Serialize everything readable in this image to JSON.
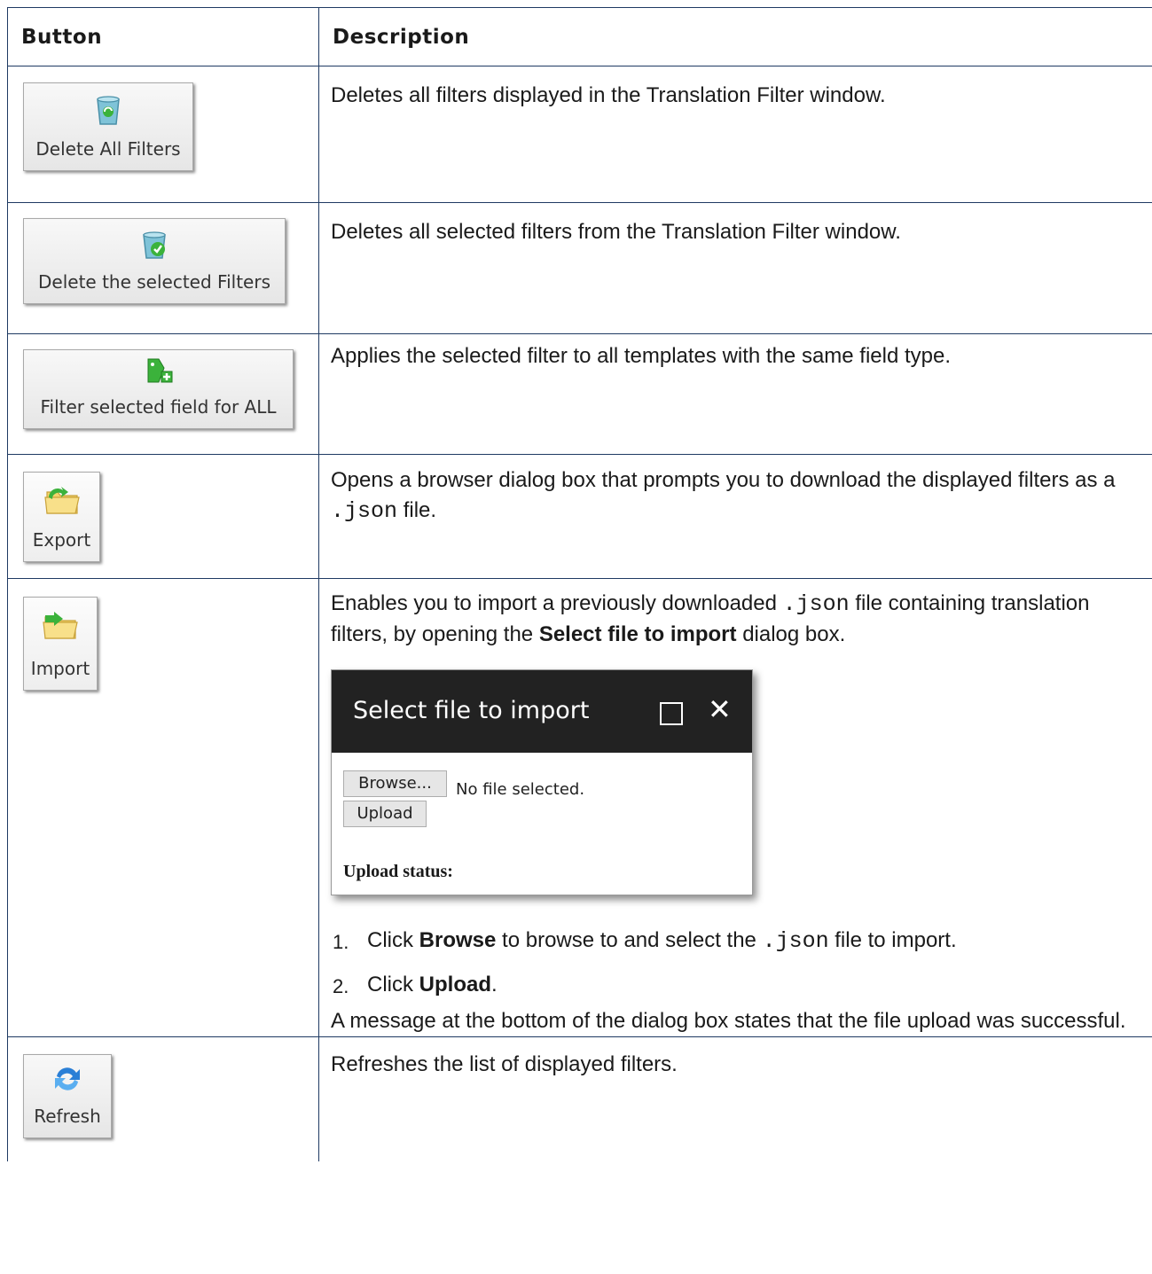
{
  "table": {
    "headers": {
      "button": "Button",
      "description": "Description"
    },
    "rows": [
      {
        "button_label": "Delete All Filters",
        "icon": "recycle-bin-icon",
        "description": "Deletes all filters displayed in the Translation Filter window."
      },
      {
        "button_label": "Delete the selected Filters",
        "icon": "recycle-bin-check-icon",
        "description": "Deletes all selected filters from the Translation Filter window."
      },
      {
        "button_label": "Filter selected field for ALL",
        "icon": "green-tag-add-icon",
        "description": "Applies the selected filter to all templates with the same field type."
      },
      {
        "button_label": "Export",
        "icon": "folder-export-icon",
        "description_pre": "Opens a browser dialog box that prompts you to download the displayed filters as a",
        "description_code": ".json",
        "description_post": "file."
      },
      {
        "button_label": "Import",
        "icon": "folder-import-icon",
        "description_pre": "Enables you to import a previously downloaded",
        "description_code": ".json",
        "description_mid": "file containing translation filters, by opening the",
        "description_bold": "Select file to import",
        "description_post": "dialog box.",
        "dialog": {
          "title": "Select file to import",
          "browse_label": "Browse...",
          "no_file_text": "No file selected.",
          "upload_label": "Upload",
          "status_label": "Upload status:"
        },
        "steps": [
          {
            "num": "1.",
            "pre": "Click",
            "bold": "Browse",
            "post": "to browse to and select the",
            "code": ".json",
            "post2": "file to import."
          },
          {
            "num": "2.",
            "pre": "Click",
            "bold": "Upload",
            "post": "."
          }
        ],
        "note": "A message at the bottom of the dialog box states that the file upload was successful."
      },
      {
        "button_label": "Refresh",
        "icon": "refresh-arrows-icon",
        "description": "Refreshes the list of displayed filters."
      }
    ]
  },
  "colors": {
    "border": "#1f3a63",
    "dialog_bar": "#222222",
    "icon_green": "#3bb23b",
    "icon_blue": "#2a7fd6"
  }
}
